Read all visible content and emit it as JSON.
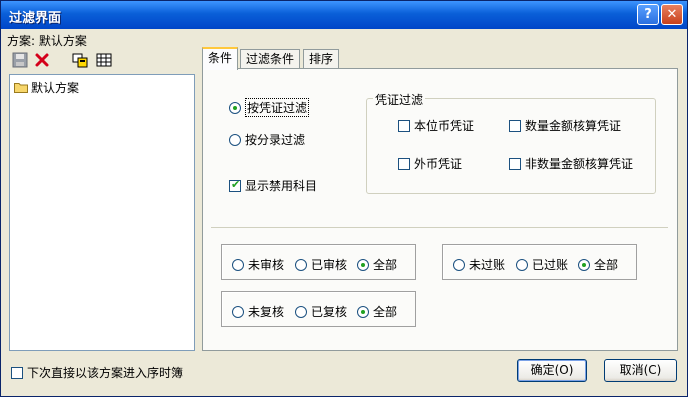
{
  "window": {
    "title": "过滤界面",
    "help_glyph": "?",
    "close_glyph": "✕"
  },
  "scheme": {
    "label": "方案: 默认方案"
  },
  "toolbar": {
    "icons": [
      "save-icon",
      "delete-icon",
      "edit-scheme-icon",
      "table-icon"
    ]
  },
  "tree": {
    "items": [
      {
        "label": "默认方案"
      }
    ]
  },
  "tabs": [
    {
      "label": "条件"
    },
    {
      "label": "过滤条件"
    },
    {
      "label": "排序"
    }
  ],
  "filter_mode": {
    "by_voucher": "按凭证过滤",
    "by_entry": "按分录过滤",
    "selected": "by_voucher"
  },
  "show_disabled": {
    "label": "显示禁用科目",
    "checked": true
  },
  "voucher_filter": {
    "title": "凭证过滤",
    "options": [
      {
        "label": "本位币凭证",
        "checked": false
      },
      {
        "label": "数量金额核算凭证",
        "checked": false
      },
      {
        "label": "外币凭证",
        "checked": false
      },
      {
        "label": "非数量金额核算凭证",
        "checked": false
      }
    ]
  },
  "audit_status": {
    "options": [
      "未审核",
      "已审核",
      "全部"
    ],
    "selected": "全部"
  },
  "posting_status": {
    "options": [
      "未过账",
      "已过账",
      "全部"
    ],
    "selected": "全部"
  },
  "recheck_status": {
    "options": [
      "未复核",
      "已复核",
      "全部"
    ],
    "selected": "全部"
  },
  "footer": {
    "remember_label": "下次直接以该方案进入序时簿",
    "remember_checked": false,
    "ok_label": "确定(O)",
    "cancel_label": "取消(C)"
  }
}
